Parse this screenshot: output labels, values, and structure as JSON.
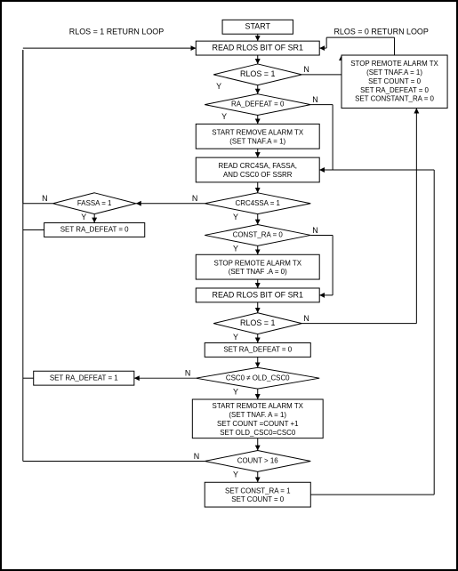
{
  "labels": {
    "start": "START",
    "read_rlos_sr1": "READ RLOS BIT OF SR1",
    "rlos1_loop": "RLOS = 1 RETURN LOOP",
    "rlos0_loop": "RLOS = 0 RETURN LOOP",
    "rlos_eq1": "RLOS = 1",
    "ra_defeat_eq0": "RA_DEFEAT = 0",
    "start_remove_alarm_l1": "START REMOVE ALARM TX",
    "start_remove_alarm_l2": "(SET TNAF.A = 1)",
    "read_crc4sa_l1": "READ CRC4SA, FASSA,",
    "read_crc4sa_l2": "AND CSC0 OF SSRR",
    "crc4ssa_eq1": "CRC4SSA = 1",
    "fassa_eq1": "FASSA = 1",
    "set_ra_defeat_0": "SET RA_DEFEAT = 0",
    "const_ra_eq0": "CONST_RA = 0",
    "stop_remote_alarm_l1": "STOP REMOTE ALARM TX",
    "stop_remote_alarm_l2": "(SET TNAF .A = 0)",
    "read_rlos_sr1_b": "READ RLOS BIT OF SR1",
    "rlos_eq1_b": "RLOS = 1",
    "set_ra_defeat_0_b": "SET RA_DEFEAT = 0",
    "set_ra_defeat_1": "SET RA_DEFEAT = 1",
    "csc0_ne_old": "CSC0 ≠ OLD_CSC0",
    "start_remote_l1": "START REMOTE ALARM TX",
    "start_remote_l2": "(SET TNAF. A = 1)",
    "start_remote_l3": "SET COUNT =COUNT +1",
    "start_remote_l4": "SET OLD_CSC0=CSC0",
    "count_gt16": "COUNT > 16",
    "set_const_ra_l1": "SET CONST_RA = 1",
    "set_const_ra_l2": "SET COUNT = 0",
    "y": "Y",
    "n": "N",
    "stop_block_l1": "STOP REMOTE ALARM TX",
    "stop_block_l2": "(SET TNAF.A = 1)",
    "stop_block_l3": "SET COUNT = 0",
    "stop_block_l4": "SET RA_DEFEAT = 0",
    "stop_block_l5": "SET CONSTANT_RA = 0"
  },
  "chart_data": {
    "type": "flowchart",
    "nodes": [
      {
        "id": "start",
        "type": "terminal",
        "text": "START"
      },
      {
        "id": "read1",
        "type": "process",
        "text": "READ RLOS BIT OF SR1"
      },
      {
        "id": "d_rlos1",
        "type": "decision",
        "text": "RLOS = 1"
      },
      {
        "id": "d_radefeat",
        "type": "decision",
        "text": "RA_DEFEAT = 0"
      },
      {
        "id": "p_startremove",
        "type": "process",
        "text": "START REMOVE ALARM TX (SET TNAF.A = 1)"
      },
      {
        "id": "p_readcrc",
        "type": "process",
        "text": "READ CRC4SA, FASSA, AND CSC0 OF SSRR"
      },
      {
        "id": "d_crc4ssa",
        "type": "decision",
        "text": "CRC4SSA = 1"
      },
      {
        "id": "d_fassa",
        "type": "decision",
        "text": "FASSA = 1"
      },
      {
        "id": "p_setrad0",
        "type": "process",
        "text": "SET RA_DEFEAT = 0"
      },
      {
        "id": "d_constra",
        "type": "decision",
        "text": "CONST_RA = 0"
      },
      {
        "id": "p_stopremote",
        "type": "process",
        "text": "STOP REMOTE ALARM TX (SET TNAF .A = 0)"
      },
      {
        "id": "p_read2",
        "type": "process",
        "text": "READ RLOS BIT OF SR1"
      },
      {
        "id": "d_rlos1b",
        "type": "decision",
        "text": "RLOS = 1"
      },
      {
        "id": "p_setrad0b",
        "type": "process",
        "text": "SET RA_DEFEAT = 0"
      },
      {
        "id": "p_setrad1",
        "type": "process",
        "text": "SET RA_DEFEAT = 1"
      },
      {
        "id": "d_csc0",
        "type": "decision",
        "text": "CSC0 ≠ OLD_CSC0"
      },
      {
        "id": "p_startremote",
        "type": "process",
        "text": "START REMOTE ALARM TX (SET TNAF. A = 1) SET COUNT =COUNT +1 SET OLD_CSC0=CSC0"
      },
      {
        "id": "d_count",
        "type": "decision",
        "text": "COUNT > 16"
      },
      {
        "id": "p_setconst",
        "type": "process",
        "text": "SET CONST_RA = 1 SET COUNT = 0"
      },
      {
        "id": "p_stopblock",
        "type": "process",
        "text": "STOP REMOTE ALARM TX (SET TNAF.A = 1) SET COUNT = 0 SET RA_DEFEAT = 0 SET CONSTANT_RA = 0"
      }
    ],
    "edges": [
      {
        "from": "start",
        "to": "read1"
      },
      {
        "from": "read1",
        "to": "d_rlos1"
      },
      {
        "from": "d_rlos1",
        "to": "d_radefeat",
        "label": "Y"
      },
      {
        "from": "d_rlos1",
        "to": "p_stopblock",
        "label": "N"
      },
      {
        "from": "d_radefeat",
        "to": "p_startremove",
        "label": "Y"
      },
      {
        "from": "d_radefeat",
        "to": "p_readcrc",
        "label": "N"
      },
      {
        "from": "p_startremove",
        "to": "p_readcrc"
      },
      {
        "from": "p_readcrc",
        "to": "d_crc4ssa"
      },
      {
        "from": "d_crc4ssa",
        "to": "d_constra",
        "label": "Y"
      },
      {
        "from": "d_crc4ssa",
        "to": "d_fassa",
        "label": "N"
      },
      {
        "from": "d_fassa",
        "to": "p_setrad0",
        "label": "Y"
      },
      {
        "from": "d_fassa",
        "to": "read1",
        "label": "N",
        "note": "RLOS=1 return loop"
      },
      {
        "from": "p_setrad0",
        "to": "read1",
        "note": "RLOS=1 return loop"
      },
      {
        "from": "d_constra",
        "to": "p_stopremote",
        "label": "Y"
      },
      {
        "from": "d_constra",
        "to": "p_read2",
        "label": "N"
      },
      {
        "from": "p_stopremote",
        "to": "p_read2"
      },
      {
        "from": "p_read2",
        "to": "d_rlos1b"
      },
      {
        "from": "d_rlos1b",
        "to": "p_setrad0b",
        "label": "Y"
      },
      {
        "from": "d_rlos1b",
        "to": "p_stopblock",
        "label": "N"
      },
      {
        "from": "p_setrad0b",
        "to": "d_csc0"
      },
      {
        "from": "d_csc0",
        "to": "p_startremote",
        "label": "Y"
      },
      {
        "from": "d_csc0",
        "to": "p_setrad1",
        "label": "N"
      },
      {
        "from": "p_setrad1",
        "to": "read1",
        "note": "RLOS=1 return loop"
      },
      {
        "from": "p_startremote",
        "to": "d_count"
      },
      {
        "from": "d_count",
        "to": "p_setconst",
        "label": "Y"
      },
      {
        "from": "d_count",
        "to": "p_readcrc",
        "label": "N",
        "note": "RLOS=0 return loop"
      },
      {
        "from": "p_setconst",
        "to": "p_readcrc",
        "note": "RLOS=0 return loop"
      },
      {
        "from": "p_stopblock",
        "to": "read1",
        "note": "RLOS=0 return loop"
      }
    ]
  }
}
